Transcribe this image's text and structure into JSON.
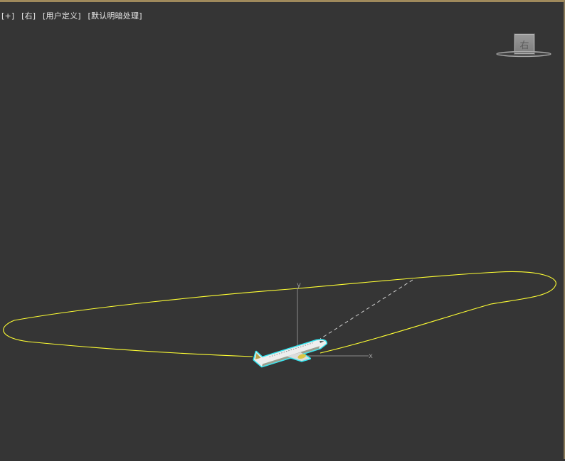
{
  "viewport": {
    "labels": {
      "plus": "[+]",
      "view": "[右]",
      "mode": "[用户定义]",
      "lighting": "[默认明暗处理]"
    },
    "viewcube_face": "右",
    "axes": {
      "x": "x",
      "y": "y"
    },
    "colors": {
      "background": "#353535",
      "path": "#ffff33",
      "selection": "#36e6f0",
      "axis": "#8a8a8a",
      "target_line": "#cfcfcf",
      "border": "#a08a5c"
    },
    "icons": [
      "viewcube-icon",
      "airplane-icon"
    ]
  }
}
